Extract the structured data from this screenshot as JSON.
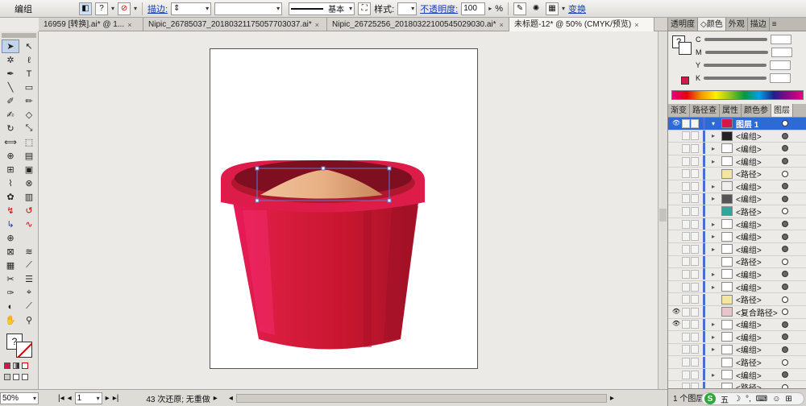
{
  "control_bar": {
    "selection_label": "编组",
    "stroke_label": "描边:",
    "stroke_profile": "基本",
    "style_label": "样式:",
    "opacity_label": "不透明度:",
    "opacity_value": "100",
    "opacity_unit": "%",
    "transform_label": "变换"
  },
  "doc_tabs": [
    {
      "label": "16959 [转换].ai* @ 1...",
      "active": false
    },
    {
      "label": "Nipic_26785037_20180321175057703037.ai*",
      "active": false
    },
    {
      "label": "Nipic_26725256_20180322100545029030.ai*",
      "active": false
    },
    {
      "label": "未标题-12* @ 50% (CMYK/预览)",
      "active": true
    }
  ],
  "status_bar": {
    "zoom": "50%",
    "page": "1",
    "undo_text": "43 次还原; 无重做"
  },
  "color_panel": {
    "tabs": [
      "透明度",
      "颜色",
      "外观",
      "描边"
    ],
    "active_tab": "颜色",
    "channels": [
      "C",
      "M",
      "Y",
      "K"
    ],
    "fill_color": "#d4164a"
  },
  "layers_panel": {
    "tabs": [
      "渐变",
      "路径查",
      "属性",
      "颜色参",
      "图层"
    ],
    "active_tab": "图层",
    "rows": [
      {
        "name": "图层 1",
        "top": true,
        "expand": "▾",
        "target": "empty"
      },
      {
        "name": "<编组>",
        "expand": "▸",
        "target": "full"
      },
      {
        "name": "<编组>",
        "expand": "▸",
        "target": "full"
      },
      {
        "name": "<编组>",
        "expand": "▸",
        "target": "full"
      },
      {
        "name": "<路径>",
        "expand": "",
        "target": "empty"
      },
      {
        "name": "<编组>",
        "expand": "▸",
        "target": "full"
      },
      {
        "name": "<编组>",
        "expand": "▸",
        "target": "full"
      },
      {
        "name": "<路径>",
        "expand": "",
        "target": "empty"
      },
      {
        "name": "<编组>",
        "expand": "▸",
        "target": "full"
      },
      {
        "name": "<编组>",
        "expand": "▸",
        "target": "full"
      },
      {
        "name": "<编组>",
        "expand": "▸",
        "target": "full"
      },
      {
        "name": "<路径>",
        "expand": "",
        "target": "empty"
      },
      {
        "name": "<编组>",
        "expand": "▸",
        "target": "full"
      },
      {
        "name": "<编组>",
        "expand": "▸",
        "target": "full"
      },
      {
        "name": "<路径>",
        "expand": "",
        "target": "empty"
      },
      {
        "name": "<复合路径>",
        "expand": "",
        "target": "empty"
      },
      {
        "name": "<编组>",
        "expand": "▸",
        "target": "full"
      },
      {
        "name": "<编组>",
        "expand": "▸",
        "target": "full"
      },
      {
        "name": "<编组>",
        "expand": "▸",
        "target": "full"
      },
      {
        "name": "<路径>",
        "expand": "",
        "target": "empty"
      },
      {
        "name": "<编组>",
        "expand": "▸",
        "target": "full"
      },
      {
        "name": "<路径>",
        "expand": "",
        "target": "empty"
      }
    ],
    "footer_count": "1 个图层"
  },
  "ime": {
    "mode": "五"
  },
  "artwork": {
    "bucket_color": "#cf1637",
    "rim_color": "#dd1c4a",
    "sand_color": "#e2a073"
  }
}
